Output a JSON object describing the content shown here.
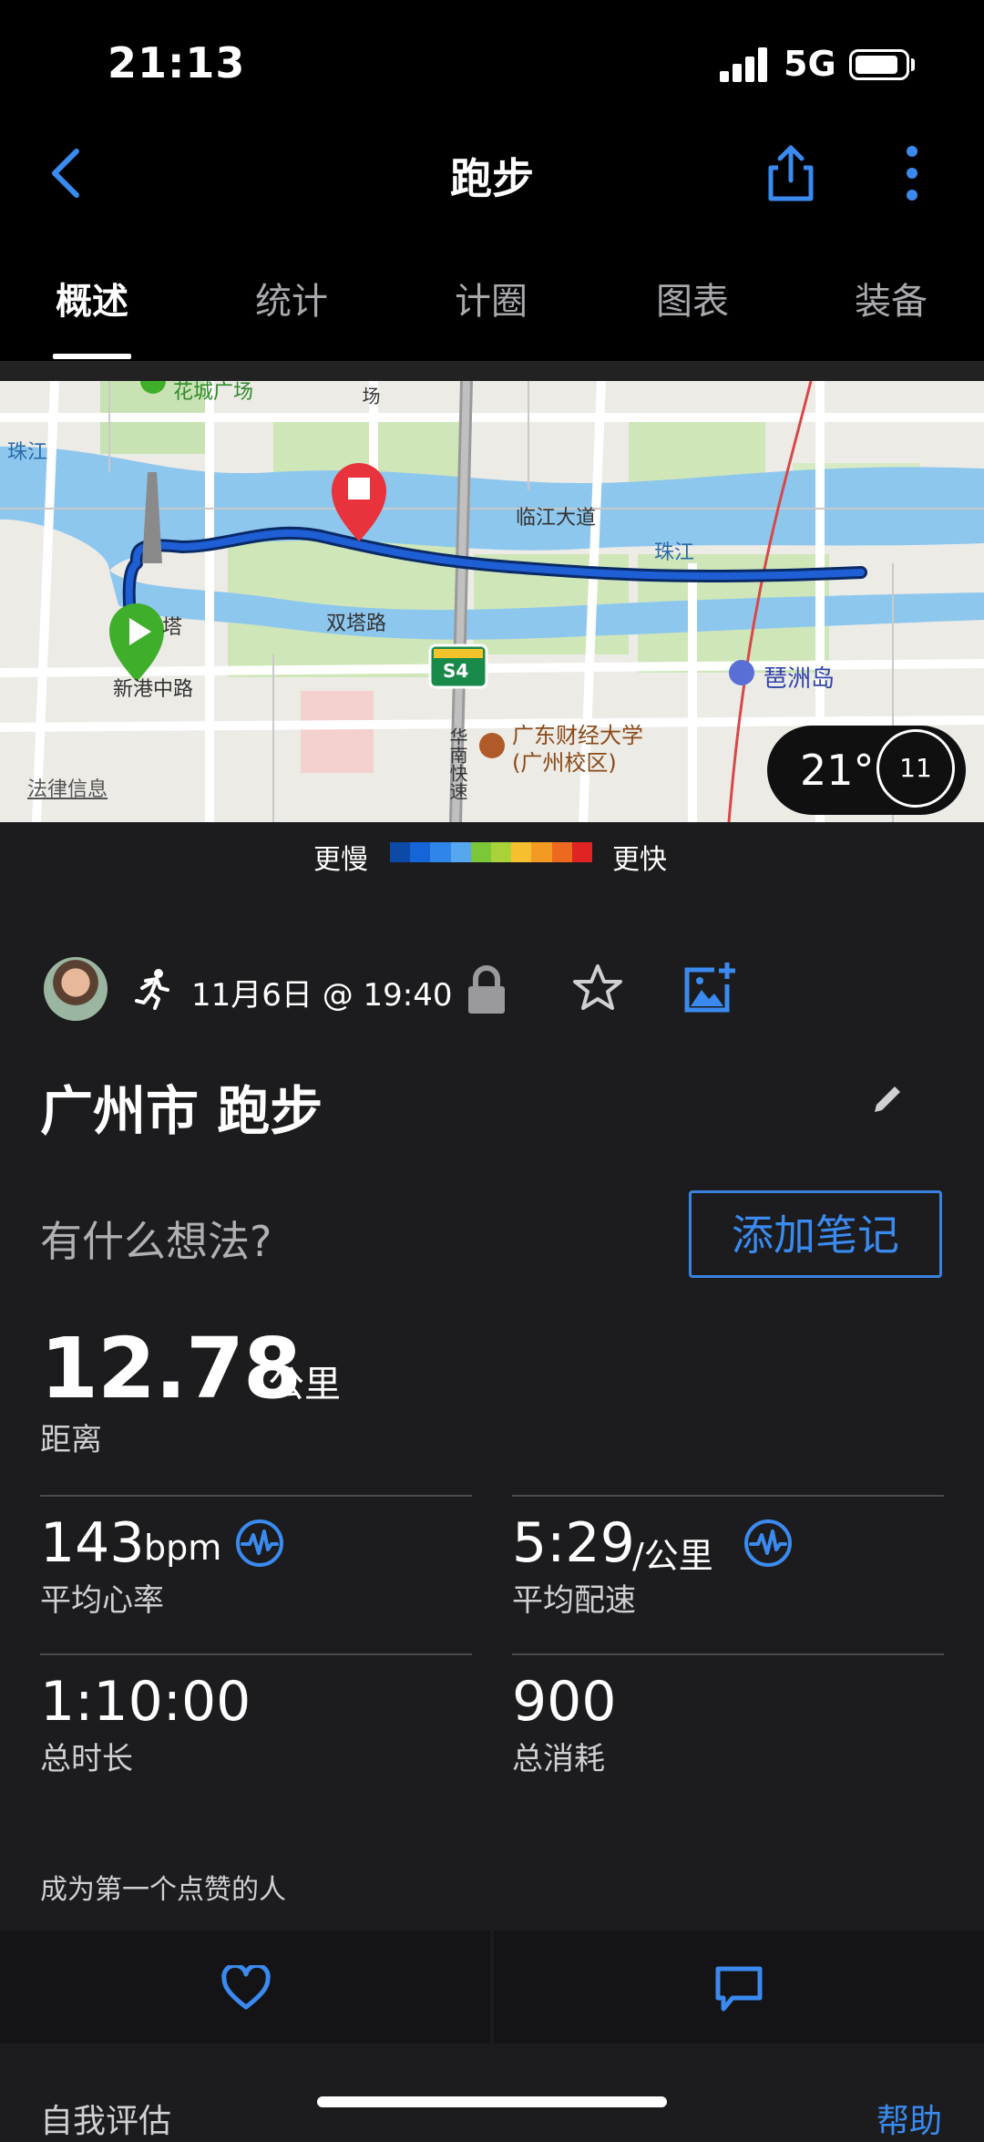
{
  "status_bar": {
    "time": "21:13",
    "network": "5G"
  },
  "header": {
    "title": "跑步"
  },
  "tabs": [
    {
      "label": "概述",
      "active": true
    },
    {
      "label": "统计",
      "active": false
    },
    {
      "label": "计圈",
      "active": false
    },
    {
      "label": "图表",
      "active": false
    },
    {
      "label": "装备",
      "active": false
    }
  ],
  "map": {
    "labels": {
      "river1": "珠江",
      "river2": "珠江",
      "road1": "临江大道",
      "road2": "双塔路",
      "road3": "新港中路",
      "tower_label": "塔",
      "island": "琶洲岛",
      "university": "广东财经大学\n(广州校区)",
      "highway": "S4",
      "expressway": "华南快速",
      "plaza": "花城广场",
      "road_top": "场",
      "legal": "法律信息"
    },
    "weather": {
      "temperature": "21°",
      "dial": "11"
    }
  },
  "pace_legend": {
    "slow": "更慢",
    "fast": "更快",
    "colors": [
      "#0d4aa8",
      "#1565d8",
      "#2f86e8",
      "#57a7f0",
      "#7cc63a",
      "#a8d13a",
      "#f4c030",
      "#f29a22",
      "#ec6a1f",
      "#e02424"
    ]
  },
  "activity": {
    "datetime": "11月6日 @ 19:40",
    "name": "广州市 跑步",
    "note_prompt": "有什么想法?",
    "add_note": "添加笔记"
  },
  "stats": {
    "distance": {
      "value": "12.78",
      "unit": "公里",
      "label": "距离"
    },
    "heart_rate": {
      "value": "143",
      "unit": "bpm",
      "label": "平均心率"
    },
    "pace": {
      "value": "5:29",
      "unit": "/公里",
      "label": "平均配速"
    },
    "duration": {
      "value": "1:10:00",
      "label": "总时长"
    },
    "calories": {
      "value": "900",
      "label": "总消耗"
    }
  },
  "kudos": "成为第一个点赞的人",
  "footer": {
    "self_eval": "自我评估",
    "help": "帮助"
  },
  "colors": {
    "accent": "#3a8aef",
    "route": "#1f5fd6",
    "start": "#3fae2a",
    "finish": "#e8323c"
  }
}
